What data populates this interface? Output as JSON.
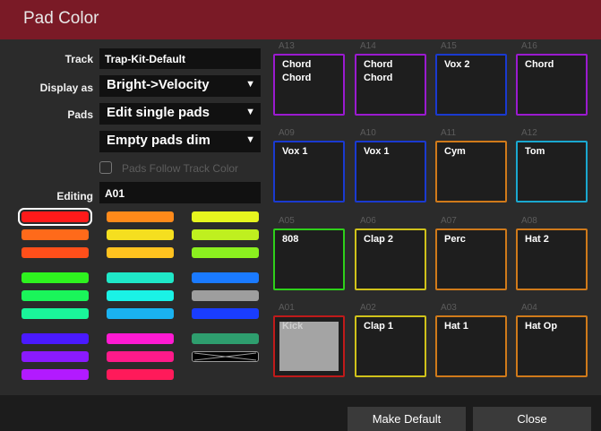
{
  "window": {
    "title": "Pad Color"
  },
  "form": {
    "track_label": "Track",
    "track_value": "Trap-Kit-Default",
    "display_label": "Display as",
    "display_value": "Bright->Velocity",
    "pads_label": "Pads",
    "pads_value": "Edit single pads",
    "empty_value": "Empty pads dim",
    "follow_label": "Pads Follow Track Color",
    "editing_label": "Editing",
    "editing_value": "A01"
  },
  "palette": [
    {
      "color": "#ff1a1a",
      "selected": true
    },
    {
      "color": "#ff8a1a"
    },
    {
      "color": "#e6f51f"
    },
    {
      "color": "#ff6a1a"
    },
    {
      "color": "#f5df1f"
    },
    {
      "color": "#bff01f"
    },
    {
      "color": "#ff4f1a"
    },
    {
      "color": "#ffc21f"
    },
    {
      "color": "#8bf01f"
    },
    {
      "color": "#2ef21f"
    },
    {
      "color": "#1fe8c8"
    },
    {
      "color": "#1a7aff"
    },
    {
      "color": "#1af55a"
    },
    {
      "color": "#1af2e6"
    },
    {
      "color": "#9e9e9e"
    },
    {
      "color": "#1af59a"
    },
    {
      "color": "#1ab2f0"
    },
    {
      "color": "#1a3dff"
    },
    {
      "color": "#4a1aff"
    },
    {
      "color": "#ff1ad2"
    },
    {
      "color": "#2e9e6e"
    },
    {
      "color": "#8a1aff"
    },
    {
      "color": "#ff1a8a"
    },
    {
      "color": "none"
    },
    {
      "color": "#b21aff"
    },
    {
      "color": "#ff1a5a"
    },
    {
      "color": ""
    }
  ],
  "pads": [
    {
      "id": "A13",
      "line1": "Chord",
      "line2": "Chord",
      "color": "#9b1ad0"
    },
    {
      "id": "A14",
      "line1": "Chord",
      "line2": "Chord",
      "color": "#9b1ad0"
    },
    {
      "id": "A15",
      "line1": "Vox 2",
      "line2": "",
      "color": "#1a3ad0"
    },
    {
      "id": "A16",
      "line1": "Chord",
      "line2": "",
      "color": "#9b1ad0"
    },
    {
      "id": "A09",
      "line1": "Vox 1",
      "line2": "",
      "color": "#1a3ad0"
    },
    {
      "id": "A10",
      "line1": "Vox 1",
      "line2": "",
      "color": "#1a3ad0"
    },
    {
      "id": "A11",
      "line1": "Cym",
      "line2": "",
      "color": "#d07a1a"
    },
    {
      "id": "A12",
      "line1": "Tom",
      "line2": "",
      "color": "#1aa8d0"
    },
    {
      "id": "A05",
      "line1": "808",
      "line2": "",
      "color": "#2ed01a"
    },
    {
      "id": "A06",
      "line1": "Clap 2",
      "line2": "",
      "color": "#d0c21a"
    },
    {
      "id": "A07",
      "line1": "Perc",
      "line2": "",
      "color": "#d07a1a"
    },
    {
      "id": "A08",
      "line1": "Hat 2",
      "line2": "",
      "color": "#d07a1a"
    },
    {
      "id": "A01",
      "line1": "Kick",
      "line2": "",
      "color": "#c01a1a",
      "filled": true
    },
    {
      "id": "A02",
      "line1": "Clap 1",
      "line2": "",
      "color": "#d0c21a"
    },
    {
      "id": "A03",
      "line1": "Hat 1",
      "line2": "",
      "color": "#d07a1a"
    },
    {
      "id": "A04",
      "line1": "Hat Op",
      "line2": "",
      "color": "#d07a1a"
    }
  ],
  "buttons": {
    "make_default": "Make Default",
    "close": "Close"
  },
  "icons": {
    "caret": "triangle-down-icon",
    "no_color": "no-color-swatch-icon"
  }
}
